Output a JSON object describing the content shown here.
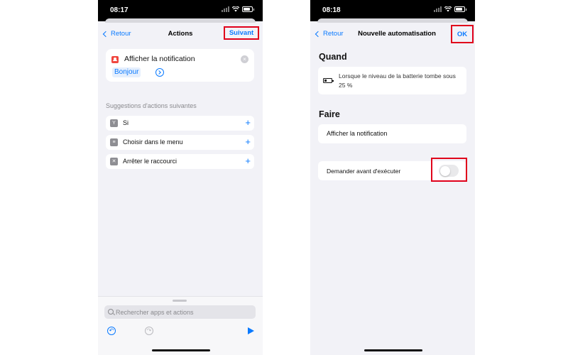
{
  "left_screen": {
    "status_bar": {
      "time": "08:17"
    },
    "nav": {
      "back_label": "Retour",
      "title": "Actions",
      "next_label": "Suivant"
    },
    "action_card": {
      "title": "Afficher la notification",
      "parameter": "Bonjour"
    },
    "suggestions": {
      "header": "Suggestions d'actions suivantes",
      "items": [
        {
          "label": "Si",
          "icon": "branch-icon"
        },
        {
          "label": "Choisir dans le menu",
          "icon": "menu-icon"
        },
        {
          "label": "Arrêter le raccourci",
          "icon": "stop-icon"
        }
      ]
    },
    "search": {
      "placeholder": "Rechercher apps et actions"
    }
  },
  "right_screen": {
    "status_bar": {
      "time": "08:18"
    },
    "nav": {
      "back_label": "Retour",
      "title": "Nouvelle automatisation",
      "ok_label": "OK"
    },
    "when": {
      "title": "Quand",
      "condition": "Lorsque le niveau de la batterie tombe sous 25 %"
    },
    "do": {
      "title": "Faire",
      "action": "Afficher la notification"
    },
    "ask_before_running": {
      "label": "Demander avant d'exécuter",
      "enabled": false
    }
  },
  "colors": {
    "accent": "#0a7aff",
    "highlight": "#e0001b",
    "background": "#f2f2f7"
  }
}
